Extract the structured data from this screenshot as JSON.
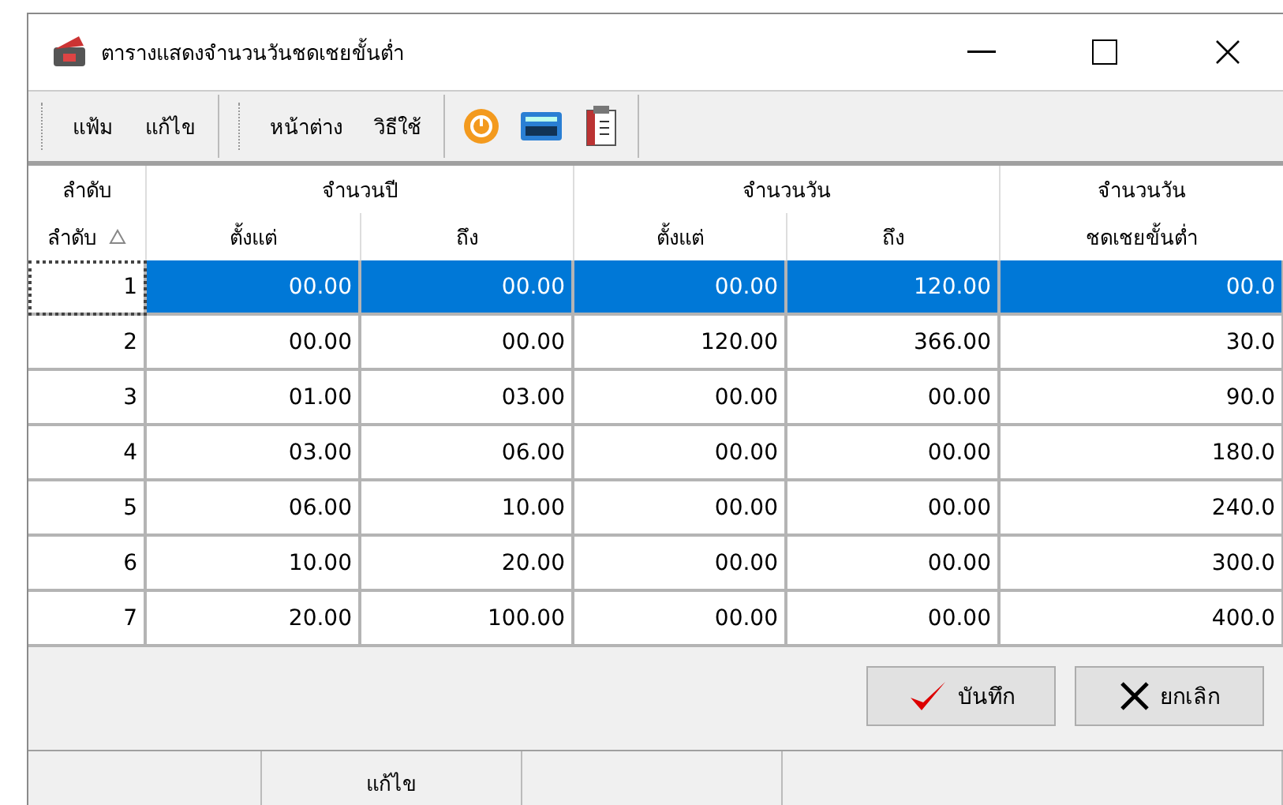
{
  "window": {
    "title": "ตารางแสดงจำนวนวันชดเชยขั้นต่ำ"
  },
  "menu": [
    {
      "label": "แฟ้ม"
    },
    {
      "label": "แก้ไข"
    },
    {
      "label": "หน้าต่าง"
    },
    {
      "label": "วิธีใช้"
    }
  ],
  "table": {
    "group_headers": [
      {
        "label": "ลำดับ"
      },
      {
        "label": "จำนวนปี"
      },
      {
        "label": "จำนวนวัน"
      },
      {
        "label": "จำนวนวัน"
      }
    ],
    "columns": [
      {
        "label": "ลำดับ",
        "sorted": true
      },
      {
        "label": "ตั้งแต่",
        "sorted": false
      },
      {
        "label": "ถึง",
        "sorted": false
      },
      {
        "label": "ตั้งแต่",
        "sorted": false
      },
      {
        "label": "ถึง",
        "sorted": false
      },
      {
        "label": "ชดเชยขั้นต่ำ",
        "sorted": false
      }
    ],
    "rows": [
      {
        "selected": true,
        "cells": [
          "1",
          "00.00",
          "00.00",
          "00.00",
          "120.00",
          "00.0"
        ]
      },
      {
        "selected": false,
        "cells": [
          "2",
          "00.00",
          "00.00",
          "120.00",
          "366.00",
          "30.0"
        ]
      },
      {
        "selected": false,
        "cells": [
          "3",
          "01.00",
          "03.00",
          "00.00",
          "00.00",
          "90.0"
        ]
      },
      {
        "selected": false,
        "cells": [
          "4",
          "03.00",
          "06.00",
          "00.00",
          "00.00",
          "180.0"
        ]
      },
      {
        "selected": false,
        "cells": [
          "5",
          "06.00",
          "10.00",
          "00.00",
          "00.00",
          "240.0"
        ]
      },
      {
        "selected": false,
        "cells": [
          "6",
          "10.00",
          "20.00",
          "00.00",
          "00.00",
          "300.0"
        ]
      },
      {
        "selected": false,
        "cells": [
          "7",
          "20.00",
          "100.00",
          "00.00",
          "00.00",
          "400.0"
        ]
      }
    ]
  },
  "buttons": [
    {
      "kind": "save",
      "label": "บันทึก"
    },
    {
      "kind": "cancel",
      "label": "ยกเลิก"
    }
  ],
  "status_bar": {
    "mode": "แก้ไข"
  }
}
